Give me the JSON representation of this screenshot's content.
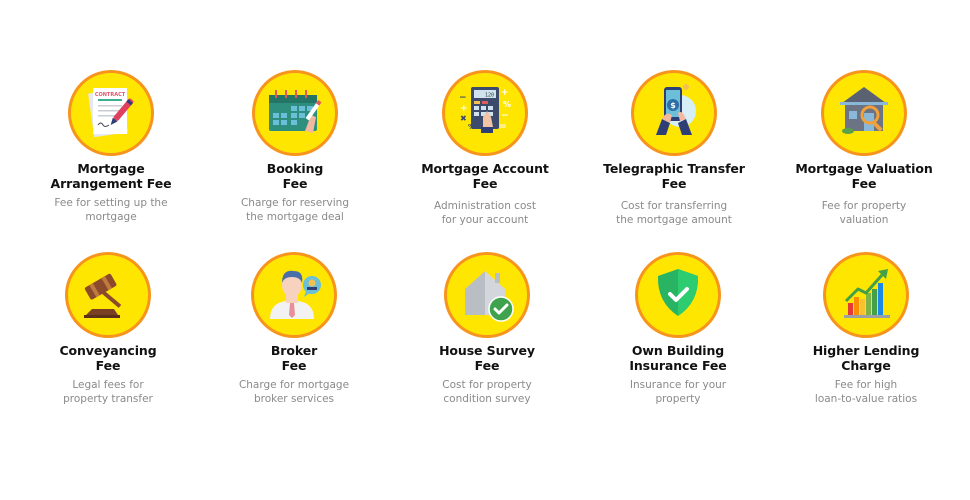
{
  "colors": {
    "circle_fill": "#ffe600",
    "circle_border": "#f7941d",
    "title_text": "#111111",
    "desc_text": "#8a8a8a"
  },
  "fees": [
    {
      "icon": "contract-icon",
      "title": [
        "Mortgage",
        "Arrangement Fee"
      ],
      "desc": [
        "Fee for setting up the",
        "mortgage"
      ]
    },
    {
      "icon": "calendar-icon",
      "title": [
        "Booking",
        "Fee"
      ],
      "desc": [
        "Charge for reserving",
        "the mortgage deal"
      ]
    },
    {
      "icon": "calculator-icon",
      "title": [
        "Mortgage Account",
        "Fee"
      ],
      "desc": [
        "Administration cost",
        "for your account"
      ]
    },
    {
      "icon": "phone-transfer-icon",
      "title": [
        "Telegraphic Transfer",
        "Fee"
      ],
      "desc": [
        "Cost for transferring",
        "the mortgage amount"
      ]
    },
    {
      "icon": "house-magnifier-icon",
      "title": [
        "Mortgage Valuation",
        "Fee"
      ],
      "desc": [
        "Fee for property",
        "valuation"
      ]
    },
    {
      "icon": "gavel-icon",
      "title": [
        "Conveyancing",
        "Fee"
      ],
      "desc": [
        "Legal fees for",
        "property transfer"
      ]
    },
    {
      "icon": "broker-icon",
      "title": [
        "Broker",
        "Fee"
      ],
      "desc": [
        "Charge for mortgage",
        "broker services"
      ]
    },
    {
      "icon": "house-check-icon",
      "title": [
        "House Survey",
        "Fee"
      ],
      "desc": [
        "Cost for property",
        "condition survey"
      ]
    },
    {
      "icon": "shield-check-icon",
      "title": [
        "Own Building",
        "Insurance Fee"
      ],
      "desc": [
        "Insurance for your",
        "property"
      ]
    },
    {
      "icon": "growth-chart-icon",
      "title": [
        "Higher Lending",
        "Charge"
      ],
      "desc": [
        "Fee for high",
        "loan-to-value ratios"
      ]
    }
  ],
  "contract_label": "CONTRACT",
  "calculator_display": "120"
}
